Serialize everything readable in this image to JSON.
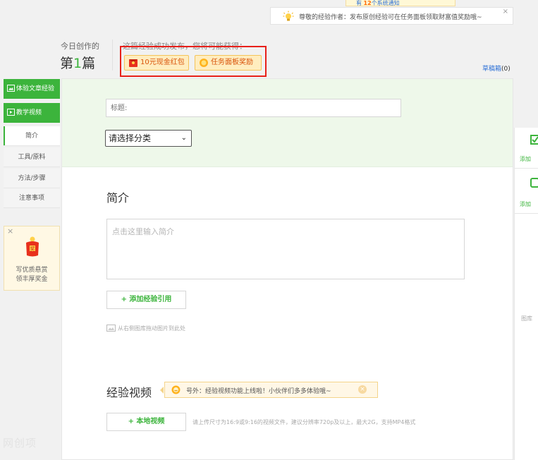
{
  "notification": {
    "count_prefix": "有",
    "count": "12",
    "count_suffix": "个系统通知",
    "message": "尊敬的经验作者：发布原创经验可在任务面板领取财富值奖励哦~",
    "close": "×"
  },
  "header": {
    "today_label": "今日创作的",
    "count_prefix": "第",
    "count_num": "1",
    "count_suffix": "篇",
    "gain_text": "这篇经验成功发布，您将可能获得：",
    "reward1": "10元现金红包",
    "reward2": "任务面板奖励",
    "drafts_label": "草稿箱",
    "drafts_count": "(0)"
  },
  "sidebar": {
    "experience": "体验文章经验",
    "video": "教学视频",
    "items": [
      "简介",
      "工具/原料",
      "方法/步骤",
      "注意事项"
    ]
  },
  "promo": {
    "close": "×",
    "line1": "写优质悬赏",
    "line2": "领丰厚奖金"
  },
  "form": {
    "title_placeholder": "标题:",
    "category_value": "请选择分类",
    "intro_heading": "简介",
    "intro_placeholder": "点击这里输入简介",
    "add_ref_button": "+ 添加经验引用",
    "image_hint": "从右侧图库拖动图片到此处",
    "video_heading": "经验视频",
    "video_tip": "号外：经验视频功能上线啦！小伙伴们多多体验哦~",
    "video_button": "+ 本地视频",
    "video_hint": "请上传尺寸为16:9或9:16的视频文件，建议分辨率720p及以上，最大2G，支持MP4格式"
  },
  "right": {
    "item1": "添加",
    "item2": "添加",
    "gallery": "图库"
  },
  "watermark": "网创项",
  "colors": {
    "accent": "#3cb43c",
    "highlight_border": "#e8201a",
    "link": "#2b6fd6"
  }
}
